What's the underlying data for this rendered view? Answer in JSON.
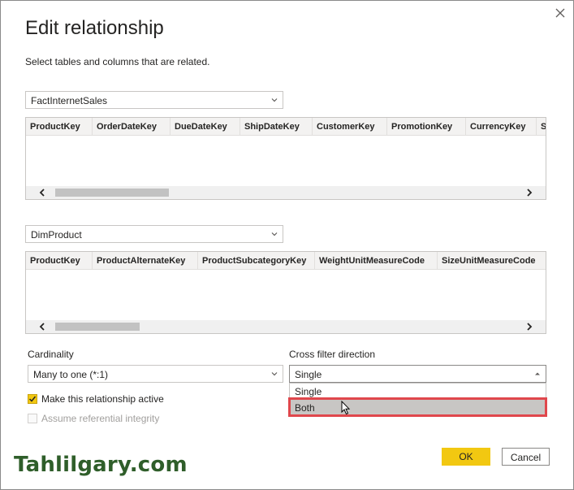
{
  "dialog": {
    "title": "Edit relationship",
    "subtitle": "Select tables and columns that are related.",
    "close_icon": "close-icon"
  },
  "table1": {
    "selected": "FactInternetSales",
    "columns": [
      "ProductKey",
      "OrderDateKey",
      "DueDateKey",
      "ShipDateKey",
      "CustomerKey",
      "PromotionKey",
      "CurrencyKey",
      "S"
    ]
  },
  "table2": {
    "selected": "DimProduct",
    "columns": [
      "ProductKey",
      "ProductAlternateKey",
      "ProductSubcategoryKey",
      "WeightUnitMeasureCode",
      "SizeUnitMeasureCode"
    ]
  },
  "cardinality": {
    "label": "Cardinality",
    "selected": "Many to one (*:1)"
  },
  "cross_filter": {
    "label": "Cross filter direction",
    "selected": "Single",
    "options": [
      "Single",
      "Both"
    ],
    "hovered": "Both"
  },
  "checkboxes": {
    "active_label": "Make this relationship active",
    "active_checked": true,
    "integrity_label": "Assume referential integrity",
    "integrity_checked": false,
    "integrity_disabled": true
  },
  "buttons": {
    "ok": "OK",
    "cancel": "Cancel"
  },
  "watermark": "Tahlilgary.com",
  "colors": {
    "accent": "#f2c811",
    "highlight": "#e0474c",
    "watermark": "#2f5e2a"
  }
}
